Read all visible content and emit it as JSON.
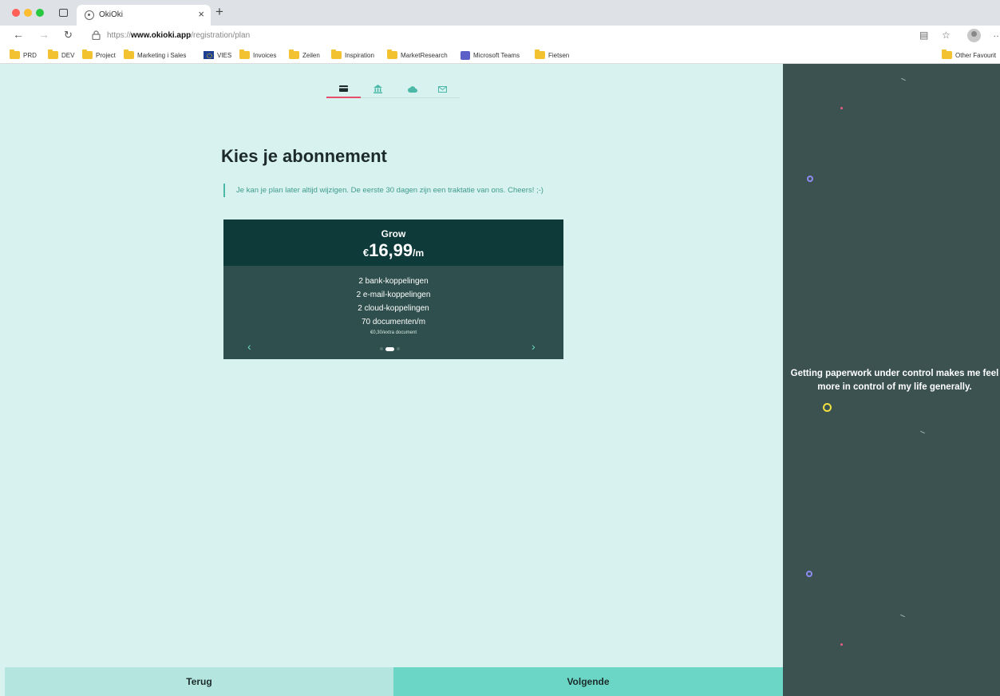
{
  "browser": {
    "tab_title": "OkiOki",
    "tab_close": "×",
    "new_tab": "+",
    "url_scheme": "https://",
    "url_domain": "www.okioki.app",
    "url_path": "/registration/plan",
    "bookmarks": [
      {
        "label": "PRD",
        "icon": "folder"
      },
      {
        "label": "DEV",
        "icon": "folder"
      },
      {
        "label": "Project",
        "icon": "folder"
      },
      {
        "label": "Marketing i Sales",
        "icon": "folder"
      },
      {
        "label": "VIES",
        "icon": "eu-flag"
      },
      {
        "label": "Invoices",
        "icon": "folder"
      },
      {
        "label": "Zeilen",
        "icon": "folder"
      },
      {
        "label": "Inspiration",
        "icon": "folder"
      },
      {
        "label": "MarketResearch",
        "icon": "folder"
      },
      {
        "label": "Microsoft Teams",
        "icon": "teams"
      },
      {
        "label": "Fietsen",
        "icon": "folder"
      }
    ],
    "other_favourites": "Other Favourit"
  },
  "steps": [
    {
      "icon": "card-icon",
      "active": true
    },
    {
      "icon": "bank-icon",
      "active": false
    },
    {
      "icon": "cloud-icon",
      "active": false
    },
    {
      "icon": "mail-icon",
      "active": false
    }
  ],
  "main": {
    "title": "Kies je abonnement",
    "notice": "Je kan je plan later altijd wijzigen. De eerste 30 dagen zijn een traktatie van ons. Cheers! ;-)"
  },
  "plan": {
    "name": "Grow",
    "currency": "€",
    "price": "16,99",
    "period": "/m",
    "features": [
      "2 bank-koppelingen",
      "2 e-mail-koppelingen",
      "2 cloud-koppelingen",
      "70 documenten/m"
    ],
    "note": "€0,30/extra document",
    "prev": "‹",
    "next": "›",
    "active_index": 1,
    "count": 3
  },
  "footer": {
    "back_label": "Terug",
    "next_label": "Volgende"
  },
  "panel": {
    "quote": "Getting paperwork under control makes me feel more in control of my life generally."
  },
  "colors": {
    "page_bg": "#d8f3ef",
    "panel_bg": "#3b5251",
    "accent": "#6cd6c6",
    "active_step": "#e74c6b",
    "plan_header": "#0e3b39",
    "plan_body": "#2e4f4d"
  }
}
